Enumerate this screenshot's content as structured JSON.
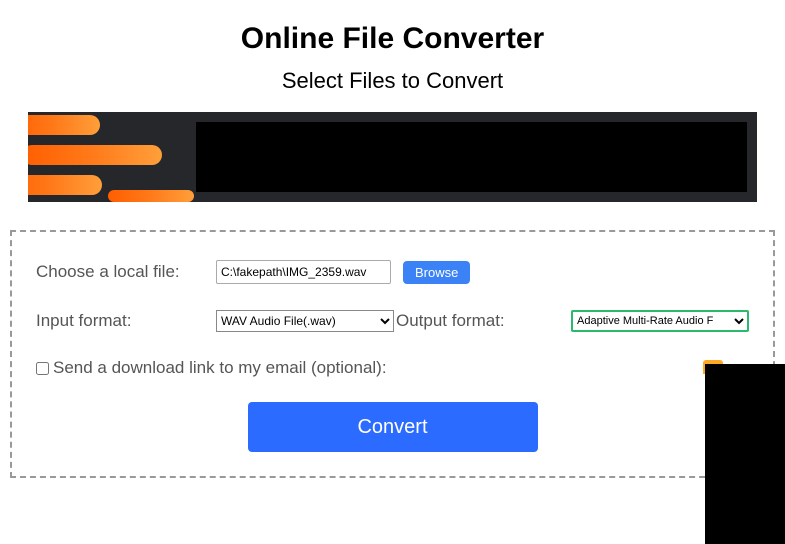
{
  "header": {
    "title": "Online File Converter",
    "subtitle": "Select Files to Convert"
  },
  "form": {
    "file_label": "Choose a local file:",
    "file_value": "C:\\fakepath\\IMG_2359.wav",
    "browse_label": "Browse",
    "input_format_label": "Input format:",
    "input_format_selected": "WAV Audio File(.wav)",
    "output_format_label": "Output format:",
    "output_format_selected": "Adaptive Multi-Rate Audio F",
    "email_checkbox_label": "Send a download link to my email (optional):",
    "convert_label": "Convert"
  }
}
